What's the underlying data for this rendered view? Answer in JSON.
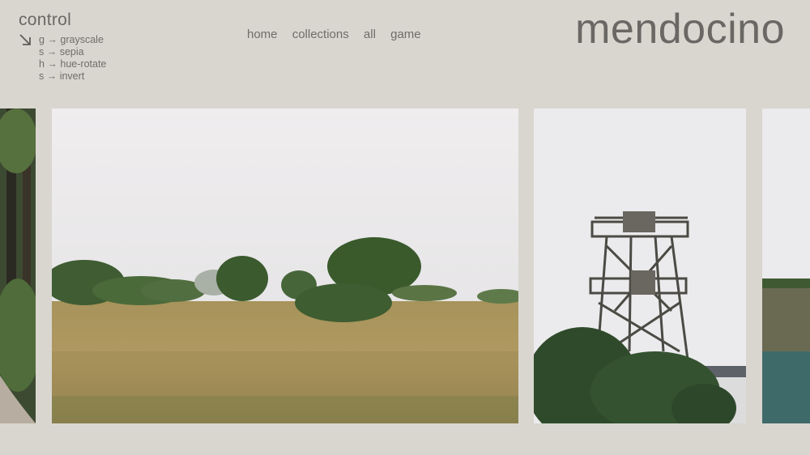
{
  "control": {
    "title": "control",
    "shortcuts": [
      {
        "label": "g → grayscale"
      },
      {
        "label": "s → sepia"
      },
      {
        "label": "h → hue-rotate"
      },
      {
        "label": "s → invert"
      }
    ]
  },
  "nav": {
    "items": [
      {
        "label": "home"
      },
      {
        "label": "collections"
      },
      {
        "label": "all"
      },
      {
        "label": "game"
      }
    ]
  },
  "brand": {
    "title": "mendocino"
  },
  "icons": {
    "control_arrow": "arrow-down-right-icon"
  },
  "colors": {
    "background": "#d9d6d0",
    "text": "#6f6d69"
  }
}
